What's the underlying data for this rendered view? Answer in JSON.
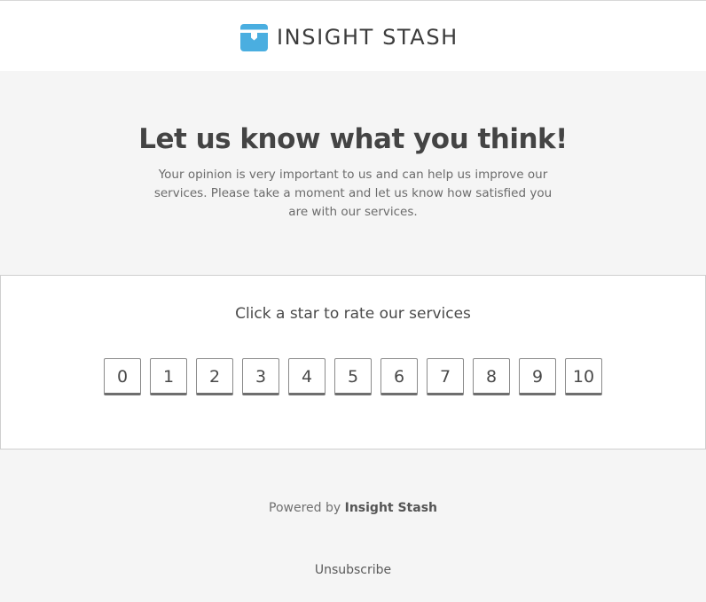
{
  "brand": {
    "name": "INSIGHT STASH",
    "icon": "insight-stash-logo-icon",
    "accent_color": "#4aaee0"
  },
  "hero": {
    "title": "Let us know what you think!",
    "description": "Your opinion is very important to us and can help us improve our services. Please take a moment and let us know how satisfied you are with our services."
  },
  "rating": {
    "prompt": "Click a star to rate our services",
    "options": [
      "0",
      "1",
      "2",
      "3",
      "4",
      "5",
      "6",
      "7",
      "8",
      "9",
      "10"
    ]
  },
  "footer": {
    "powered_prefix": "Powered by",
    "powered_brand": "Insight Stash",
    "unsubscribe_label": "Unsubscribe"
  }
}
